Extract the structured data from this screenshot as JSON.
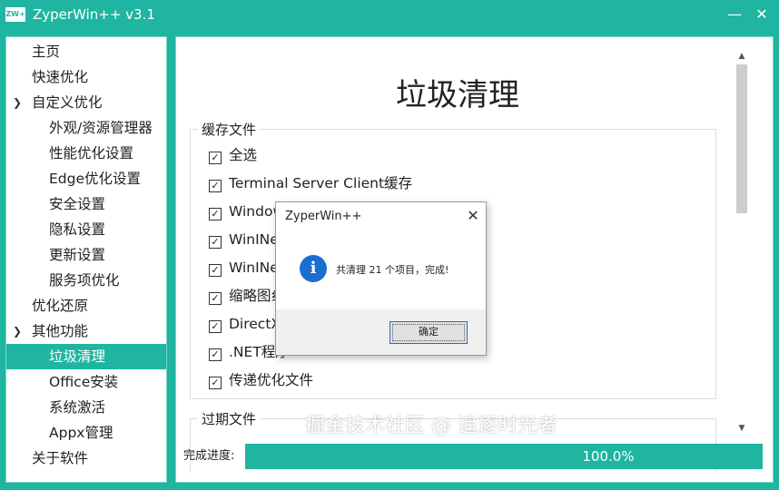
{
  "window": {
    "icon_text": "ZW+",
    "title": "ZyperWin++ v3.1",
    "minimize_glyph": "—",
    "close_glyph": "✕"
  },
  "sidebar": {
    "items": [
      {
        "label": "主页",
        "level": 0
      },
      {
        "label": "快速优化",
        "level": 0
      },
      {
        "label": "自定义优化",
        "level": 0,
        "expanded": true
      },
      {
        "label": "外观/资源管理器",
        "level": 1
      },
      {
        "label": "性能优化设置",
        "level": 1
      },
      {
        "label": "Edge优化设置",
        "level": 1
      },
      {
        "label": "安全设置",
        "level": 1
      },
      {
        "label": "隐私设置",
        "level": 1
      },
      {
        "label": "更新设置",
        "level": 1
      },
      {
        "label": "服务项优化",
        "level": 1
      },
      {
        "label": "优化还原",
        "level": 0
      },
      {
        "label": "其他功能",
        "level": 0,
        "expanded": true
      },
      {
        "label": "垃圾清理",
        "level": 1,
        "selected": true
      },
      {
        "label": "Office安装",
        "level": 1
      },
      {
        "label": "系统激活",
        "level": 1
      },
      {
        "label": "Appx管理",
        "level": 1
      },
      {
        "label": "关于软件",
        "level": 0
      }
    ]
  },
  "main": {
    "title": "垃圾清理",
    "cache_group": {
      "title": "缓存文件",
      "items": [
        {
          "label": "全选",
          "checked": true
        },
        {
          "label": "Terminal Server Client缓存",
          "checked": true
        },
        {
          "label": "Window",
          "checked": true
        },
        {
          "label": "WinINe",
          "checked": true
        },
        {
          "label": "WinINe",
          "checked": true
        },
        {
          "label": "缩略图纟",
          "checked": true
        },
        {
          "label": "DirectX",
          "checked": true
        },
        {
          "label": ".NET程序",
          "checked": true
        },
        {
          "label": "传递优化文件",
          "checked": true
        }
      ]
    },
    "expired_group": {
      "title": "过期文件"
    },
    "progress": {
      "label": "完成进度:",
      "value": 100,
      "text": "100.0%"
    },
    "watermark": "掘金技术社区 @ 追逐时光者"
  },
  "dialog": {
    "title": "ZyperWin++",
    "message": "共清理 21 个项目，完成!",
    "icon": "info-icon",
    "ok_label": "确定"
  },
  "colors": {
    "accent": "#1fb5a0",
    "info_blue": "#1a6fd1"
  }
}
